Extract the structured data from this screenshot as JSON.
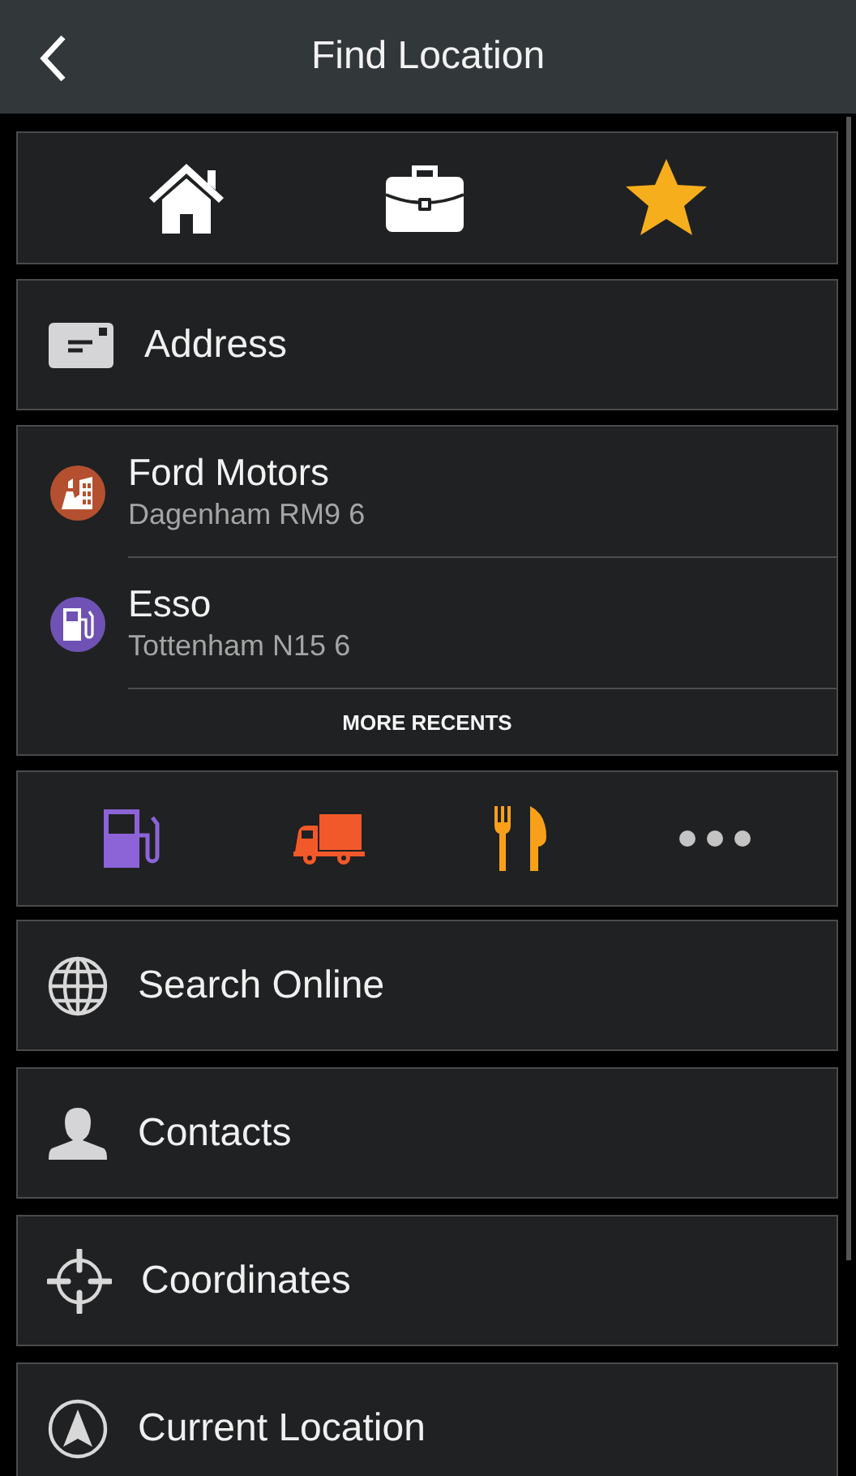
{
  "header": {
    "title": "Find Location"
  },
  "quick_access": [
    {
      "kind": "home"
    },
    {
      "kind": "work"
    },
    {
      "kind": "favorites"
    }
  ],
  "address": {
    "label": "Address"
  },
  "recents": {
    "items": [
      {
        "kind": "industry",
        "color": "#b4502f",
        "name": "Ford Motors",
        "detail": "Dagenham RM9 6"
      },
      {
        "kind": "fuel",
        "color": "#6f52b3",
        "name": "Esso",
        "detail": "Tottenham N15 6"
      }
    ],
    "more_label": "MORE RECENTS"
  },
  "categories": [
    {
      "kind": "fuel",
      "color": "#8c64d8"
    },
    {
      "kind": "truck",
      "color": "#f2592a"
    },
    {
      "kind": "food",
      "color": "#f9a01b"
    },
    {
      "kind": "more",
      "color": "#c4c4c4"
    }
  ],
  "menu": [
    {
      "kind": "globe",
      "label": "Search Online"
    },
    {
      "kind": "person",
      "label": "Contacts"
    },
    {
      "kind": "crosshair",
      "label": "Coordinates"
    },
    {
      "kind": "navigation",
      "label": "Current Location"
    }
  ]
}
